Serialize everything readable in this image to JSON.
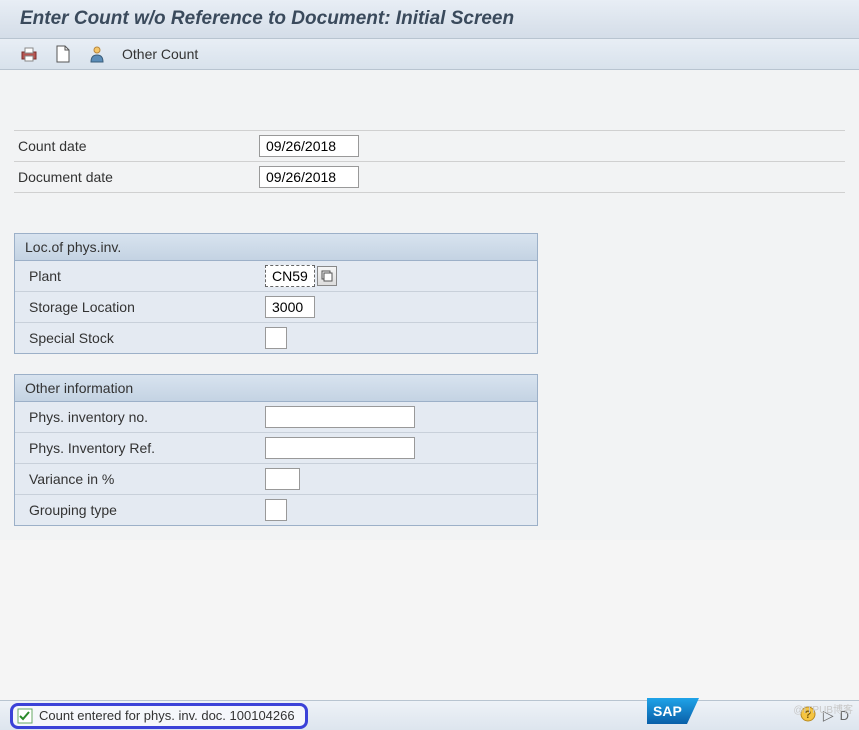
{
  "title": "Enter Count w/o Reference to Document: Initial Screen",
  "toolbar": {
    "other_count": "Other Count"
  },
  "dates": {
    "count_date_label": "Count date",
    "count_date_value": "09/26/2018",
    "doc_date_label": "Document date",
    "doc_date_value": "09/26/2018"
  },
  "loc_group": {
    "title": "Loc.of phys.inv.",
    "plant_label": "Plant",
    "plant_value": "CN59",
    "storage_label": "Storage Location",
    "storage_value": "3000",
    "special_stock_label": "Special Stock",
    "special_stock_value": ""
  },
  "other_group": {
    "title": "Other information",
    "phys_inv_no_label": "Phys. inventory no.",
    "phys_inv_no_value": "",
    "phys_inv_ref_label": "Phys. Inventory Ref.",
    "phys_inv_ref_value": "",
    "variance_label": "Variance in %",
    "variance_value": "",
    "grouping_label": "Grouping type",
    "grouping_value": ""
  },
  "status": {
    "message": "Count entered for phys. inv. doc. 100104266"
  },
  "branding": {
    "sap": "SAP",
    "watermark": "@ITPUB博客"
  }
}
